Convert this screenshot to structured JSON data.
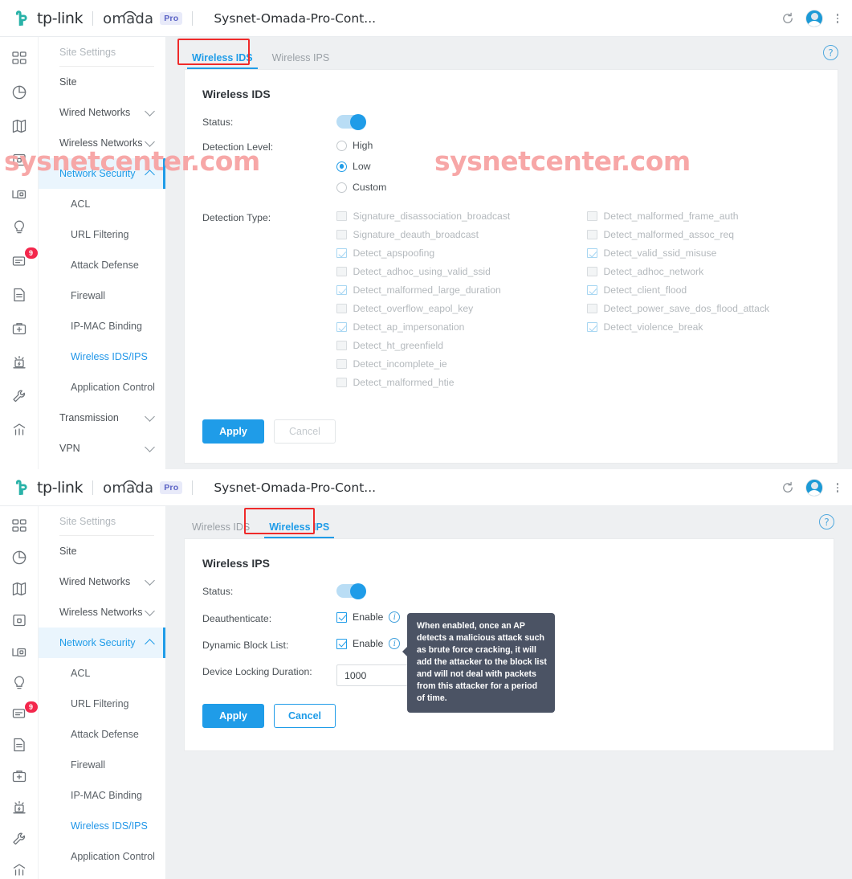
{
  "header": {
    "brand_tp": "tp-link",
    "brand_omada": "omada",
    "badge_pro": "Pro",
    "controller_name": "Sysnet-Omada-Pro-Cont...",
    "refresh_icon": "refresh-icon",
    "avatar_icon": "user-avatar-icon",
    "menu_icon": "kebab-menu-icon"
  },
  "rail": {
    "items": [
      {
        "name": "dashboard-icon",
        "badge": null
      },
      {
        "name": "statistics-icon",
        "badge": null
      },
      {
        "name": "map-icon",
        "badge": null
      },
      {
        "name": "devices-icon",
        "badge": null
      },
      {
        "name": "clients-icon",
        "badge": null
      },
      {
        "name": "insight-icon",
        "badge": null
      },
      {
        "name": "log-icon",
        "badge": "9"
      },
      {
        "name": "report-icon",
        "badge": null
      },
      {
        "name": "toolbox-icon",
        "badge": null
      },
      {
        "name": "alert-icon",
        "badge": null
      },
      {
        "name": "settings-wrench-icon",
        "badge": null
      },
      {
        "name": "analytics-icon",
        "badge": null
      }
    ]
  },
  "sidebar": {
    "title": "Site Settings",
    "items": [
      {
        "label": "Site",
        "type": "item"
      },
      {
        "label": "Wired Networks",
        "type": "group",
        "expanded": false
      },
      {
        "label": "Wireless Networks",
        "type": "group",
        "expanded": false
      },
      {
        "label": "Network Security",
        "type": "group",
        "expanded": true,
        "active": true
      },
      {
        "label": "ACL",
        "type": "sub"
      },
      {
        "label": "URL Filtering",
        "type": "sub"
      },
      {
        "label": "Attack Defense",
        "type": "sub"
      },
      {
        "label": "Firewall",
        "type": "sub"
      },
      {
        "label": "IP-MAC Binding",
        "type": "sub"
      },
      {
        "label": "Wireless IDS/IPS",
        "type": "sub",
        "selected": true
      },
      {
        "label": "Application Control",
        "type": "sub"
      },
      {
        "label": "Transmission",
        "type": "group",
        "expanded": false
      },
      {
        "label": "VPN",
        "type": "group",
        "expanded": false
      }
    ]
  },
  "ids_panel": {
    "tabs": [
      {
        "label": "Wireless IDS",
        "active": true,
        "highlighted": true
      },
      {
        "label": "Wireless IPS",
        "active": false,
        "highlighted": false
      }
    ],
    "help_icon": "question-mark-icon",
    "title": "Wireless IDS",
    "status_label": "Status:",
    "status_on": true,
    "detection_level_label": "Detection Level:",
    "detection_levels": [
      {
        "label": "High",
        "selected": false
      },
      {
        "label": "Low",
        "selected": true
      },
      {
        "label": "Custom",
        "selected": false
      }
    ],
    "detection_type_label": "Detection Type:",
    "detection_types_left": [
      {
        "label": "Signature_disassociation_broadcast",
        "checked": false
      },
      {
        "label": "Signature_deauth_broadcast",
        "checked": false
      },
      {
        "label": "Detect_apspoofing",
        "checked": true
      },
      {
        "label": "Detect_adhoc_using_valid_ssid",
        "checked": false
      },
      {
        "label": "Detect_malformed_large_duration",
        "checked": true
      },
      {
        "label": "Detect_overflow_eapol_key",
        "checked": false
      },
      {
        "label": "Detect_ap_impersonation",
        "checked": true
      },
      {
        "label": "Detect_ht_greenfield",
        "checked": false
      },
      {
        "label": "Detect_incomplete_ie",
        "checked": false
      },
      {
        "label": "Detect_malformed_htie",
        "checked": false
      }
    ],
    "detection_types_right": [
      {
        "label": "Detect_malformed_frame_auth",
        "checked": false
      },
      {
        "label": "Detect_malformed_assoc_req",
        "checked": false
      },
      {
        "label": "Detect_valid_ssid_misuse",
        "checked": true
      },
      {
        "label": "Detect_adhoc_network",
        "checked": false
      },
      {
        "label": "Detect_client_flood",
        "checked": true
      },
      {
        "label": "Detect_power_save_dos_flood_attack",
        "checked": false
      },
      {
        "label": "Detect_violence_break",
        "checked": true
      }
    ],
    "apply_label": "Apply",
    "cancel_label": "Cancel"
  },
  "ips_panel": {
    "tabs": [
      {
        "label": "Wireless IDS",
        "active": false,
        "highlighted": false
      },
      {
        "label": "Wireless IPS",
        "active": true,
        "highlighted": true
      }
    ],
    "help_icon": "question-mark-icon",
    "title": "Wireless IPS",
    "status_label": "Status:",
    "status_on": true,
    "deauthenticate_label": "Deauthenticate:",
    "deauthenticate_enable": "Enable",
    "dynamic_block_label": "Dynamic Block List:",
    "dynamic_block_enable": "Enable",
    "device_locking_label": "Device Locking Duration:",
    "device_locking_value": "1000",
    "apply_label": "Apply",
    "cancel_label": "Cancel",
    "tooltip": "When enabled, once an AP detects a malicious attack such as brute force cracking, it will add the attacker to the block list and will not deal with packets from this attacker for a period of time."
  },
  "watermark": {
    "text": "sysnetcenter.com",
    "color": "#f7a3a3"
  },
  "colors": {
    "accent": "#1f9ce8",
    "highlight_red": "#ef2a2a",
    "page_bg": "#eef0f2",
    "tooltip_bg": "#4b5364",
    "badge_red": "#f3274c"
  }
}
